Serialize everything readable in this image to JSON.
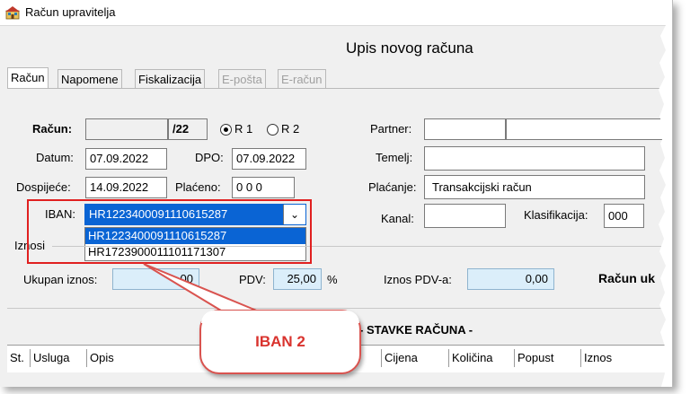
{
  "window": {
    "title": "Račun upravitelja"
  },
  "form_title": "Upis novog računa",
  "tabs": [
    {
      "label": "Račun",
      "active": true,
      "enabled": true
    },
    {
      "label": "Napomene",
      "active": false,
      "enabled": true
    },
    {
      "label": "Fiskalizacija",
      "active": false,
      "enabled": true
    },
    {
      "label": "E-pošta",
      "active": false,
      "enabled": false
    },
    {
      "label": "E-račun",
      "active": false,
      "enabled": false
    }
  ],
  "invoice": {
    "racun_label": "Račun:",
    "racun_number": "",
    "racun_suffix": "/22",
    "r1_label": "R 1",
    "r2_label": "R 2",
    "r1_selected": true,
    "datum_label": "Datum:",
    "datum_value": "07.09.2022",
    "dpo_label": "DPO:",
    "dpo_value": "07.09.2022",
    "dospijece_label": "Dospijeće:",
    "dospijece_value": "14.09.2022",
    "placeno_label": "Plaćeno:",
    "placeno_value": "0 0 0",
    "iban_label": "IBAN:",
    "iban_selected": "HR1223400091110615287",
    "iban_options": [
      "HR1223400091110615287",
      "HR1723900011101171307"
    ]
  },
  "partner": {
    "partner_label": "Partner:",
    "partner_code": "",
    "partner_name": "",
    "temelj_label": "Temelj:",
    "temelj_value": "",
    "placanje_label": "Plaćanje:",
    "placanje_value": "Transakcijski račun",
    "kanal_label": "Kanal:",
    "kanal_value": "",
    "klasifikacija_label": "Klasifikacija:",
    "klasifikacija_value": "000"
  },
  "iznosi": {
    "group_label": "Iznosi",
    "ukupan_label": "Ukupan iznos:",
    "ukupan_value": ",00",
    "pdv_label": "PDV:",
    "pdv_value": "25,00",
    "pdv_unit": "%",
    "iznos_pdv_label": "Iznos PDV-a:",
    "iznos_pdv_value": "0,00",
    "racun_uk_label": "Račun uk"
  },
  "stavke": {
    "title": "- STAVKE RAČUNA -",
    "columns": [
      "St.",
      "Usluga",
      "Opis",
      "Cijena",
      "Količina",
      "Popust",
      "Iznos"
    ]
  },
  "callout": {
    "text": "IBAN 2"
  },
  "colors": {
    "highlight": "#0a64d4",
    "annotation_red": "#e02020",
    "callout_text": "#d9332e"
  }
}
